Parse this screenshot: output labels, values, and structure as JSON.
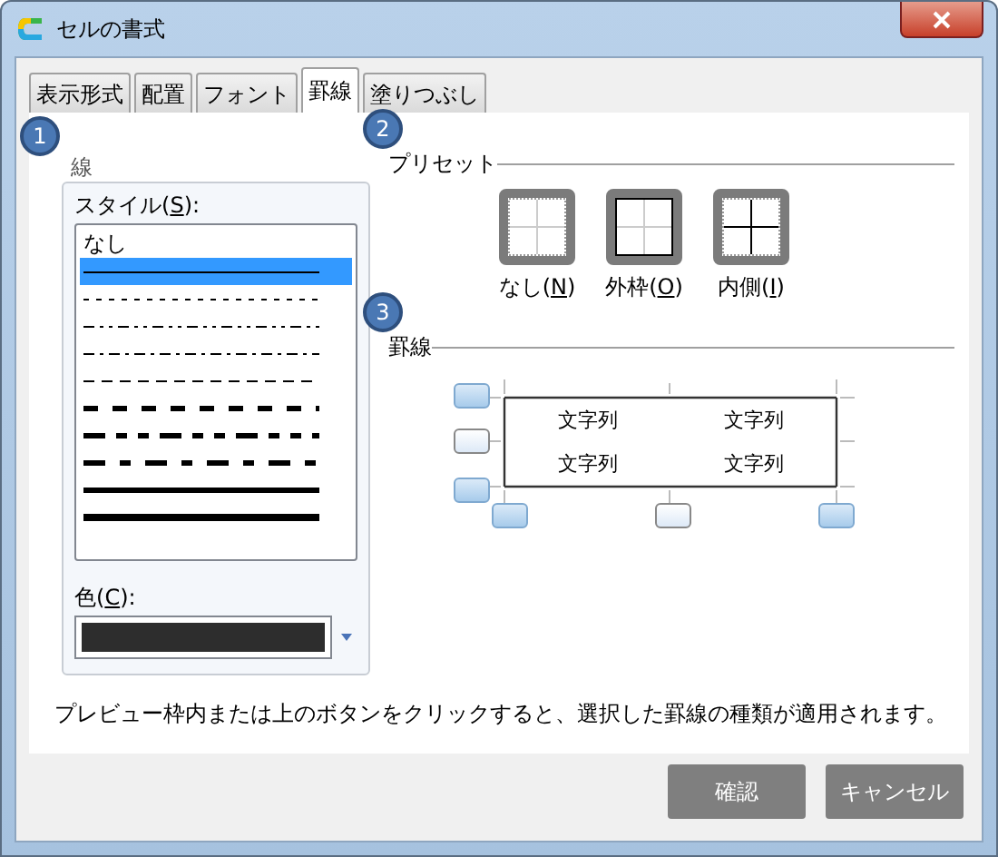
{
  "window": {
    "title": "セルの書式"
  },
  "tabs": [
    {
      "label": "表示形式",
      "selected": false
    },
    {
      "label": "配置",
      "selected": false
    },
    {
      "label": "フォント",
      "selected": false
    },
    {
      "label": "罫線",
      "selected": true
    },
    {
      "label": "塗りつぶし",
      "selected": false
    }
  ],
  "line_group": {
    "step": "1",
    "title": "線",
    "style_label": {
      "before": "スタイル(",
      "key": "S",
      "after": "):"
    },
    "styles": [
      {
        "kind": "text",
        "label": "なし",
        "selected": false
      },
      {
        "kind": "thin",
        "selected": true
      },
      {
        "kind": "hair",
        "selected": false
      },
      {
        "kind": "dash-dot-dot",
        "selected": false
      },
      {
        "kind": "dash-dot",
        "selected": false
      },
      {
        "kind": "dashed",
        "selected": false
      },
      {
        "kind": "medium-dotted",
        "selected": false
      },
      {
        "kind": "medium-dash-dot-dot",
        "selected": false
      },
      {
        "kind": "medium-dash-dot",
        "selected": false
      },
      {
        "kind": "medium",
        "selected": false
      },
      {
        "kind": "thick",
        "selected": false
      }
    ],
    "color_label": {
      "before": "色(",
      "key": "C",
      "after": "):"
    },
    "color": "#2d2d2d"
  },
  "presets": {
    "step": "2",
    "title": "プリセット",
    "items": [
      {
        "kind": "none",
        "label": {
          "before": "なし(",
          "key": "N",
          "after": ")"
        }
      },
      {
        "kind": "outline",
        "label": {
          "before": "外枠(",
          "key": "O",
          "after": ")"
        }
      },
      {
        "kind": "inside",
        "label": {
          "before": "内側(",
          "key": "I",
          "after": ")"
        }
      }
    ]
  },
  "border": {
    "step": "3",
    "title": "罫線",
    "buttons": [
      {
        "kind": "top",
        "on": true
      },
      {
        "kind": "inner-horizontal",
        "on": false
      },
      {
        "kind": "bottom",
        "on": true
      },
      {
        "kind": "left",
        "on": true
      },
      {
        "kind": "inner-vertical",
        "on": false
      },
      {
        "kind": "right",
        "on": true
      }
    ],
    "cells": [
      "文字列",
      "文字列",
      "文字列",
      "文字列"
    ]
  },
  "hint": "プレビュー枠内または上のボタンをクリックすると、選択した罫線の種類が適用されます。",
  "buttons": [
    "確認",
    "キャンセル"
  ]
}
